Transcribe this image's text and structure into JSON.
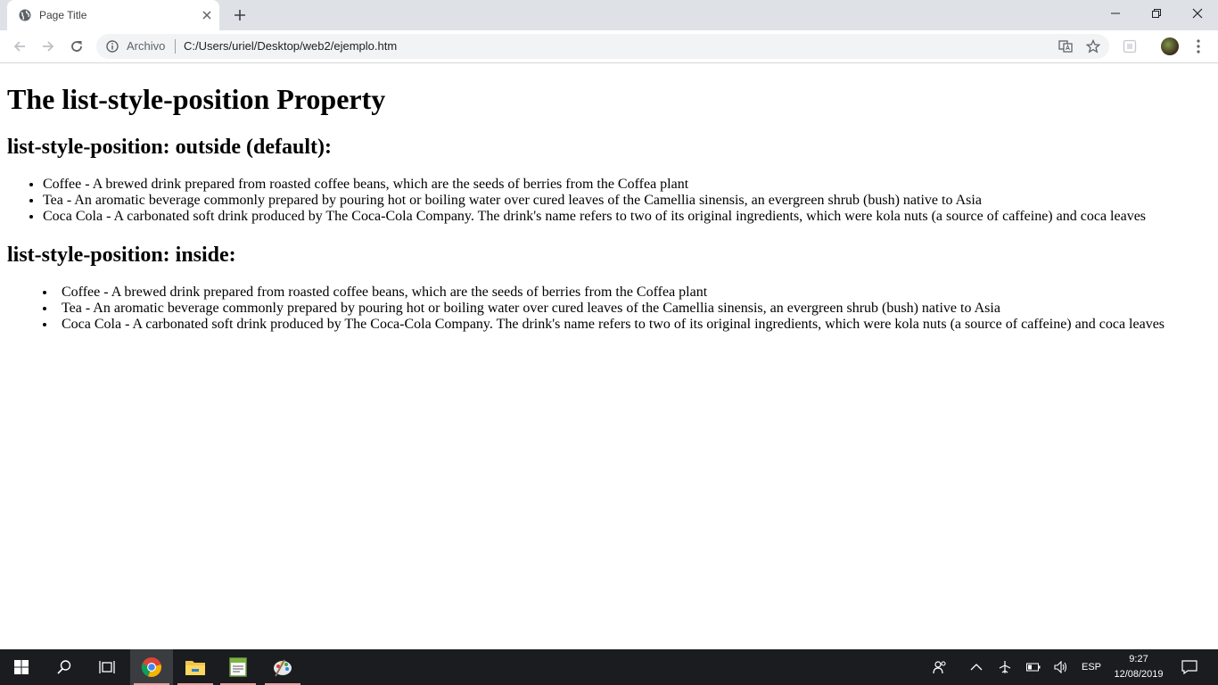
{
  "browser": {
    "tab": {
      "title": "Page Title"
    },
    "address": {
      "scheme_label": "Archivo",
      "url": "C:/Users/uriel/Desktop/web2/ejemplo.htm"
    }
  },
  "page": {
    "heading": "The list-style-position Property",
    "section_outside": {
      "title": "list-style-position: outside (default):",
      "items": [
        "Coffee - A brewed drink prepared from roasted coffee beans, which are the seeds of berries from the Coffea plant",
        "Tea - An aromatic beverage commonly prepared by pouring hot or boiling water over cured leaves of the Camellia sinensis, an evergreen shrub (bush) native to Asia",
        "Coca Cola - A carbonated soft drink produced by The Coca-Cola Company. The drink's name refers to two of its original ingredients, which were kola nuts (a source of caffeine) and coca leaves"
      ]
    },
    "section_inside": {
      "title": "list-style-position: inside:",
      "items": [
        "Coffee - A brewed drink prepared from roasted coffee beans, which are the seeds of berries from the Coffea plant",
        "Tea - An aromatic beverage commonly prepared by pouring hot or boiling water over cured leaves of the Camellia sinensis, an evergreen shrub (bush) native to Asia",
        "Coca Cola - A carbonated soft drink produced by The Coca-Cola Company. The drink's name refers to two of its original ingredients, which were kola nuts (a source of caffeine) and coca leaves"
      ]
    }
  },
  "taskbar": {
    "language": "ESP",
    "time": "9:27",
    "date": "12/08/2019"
  }
}
